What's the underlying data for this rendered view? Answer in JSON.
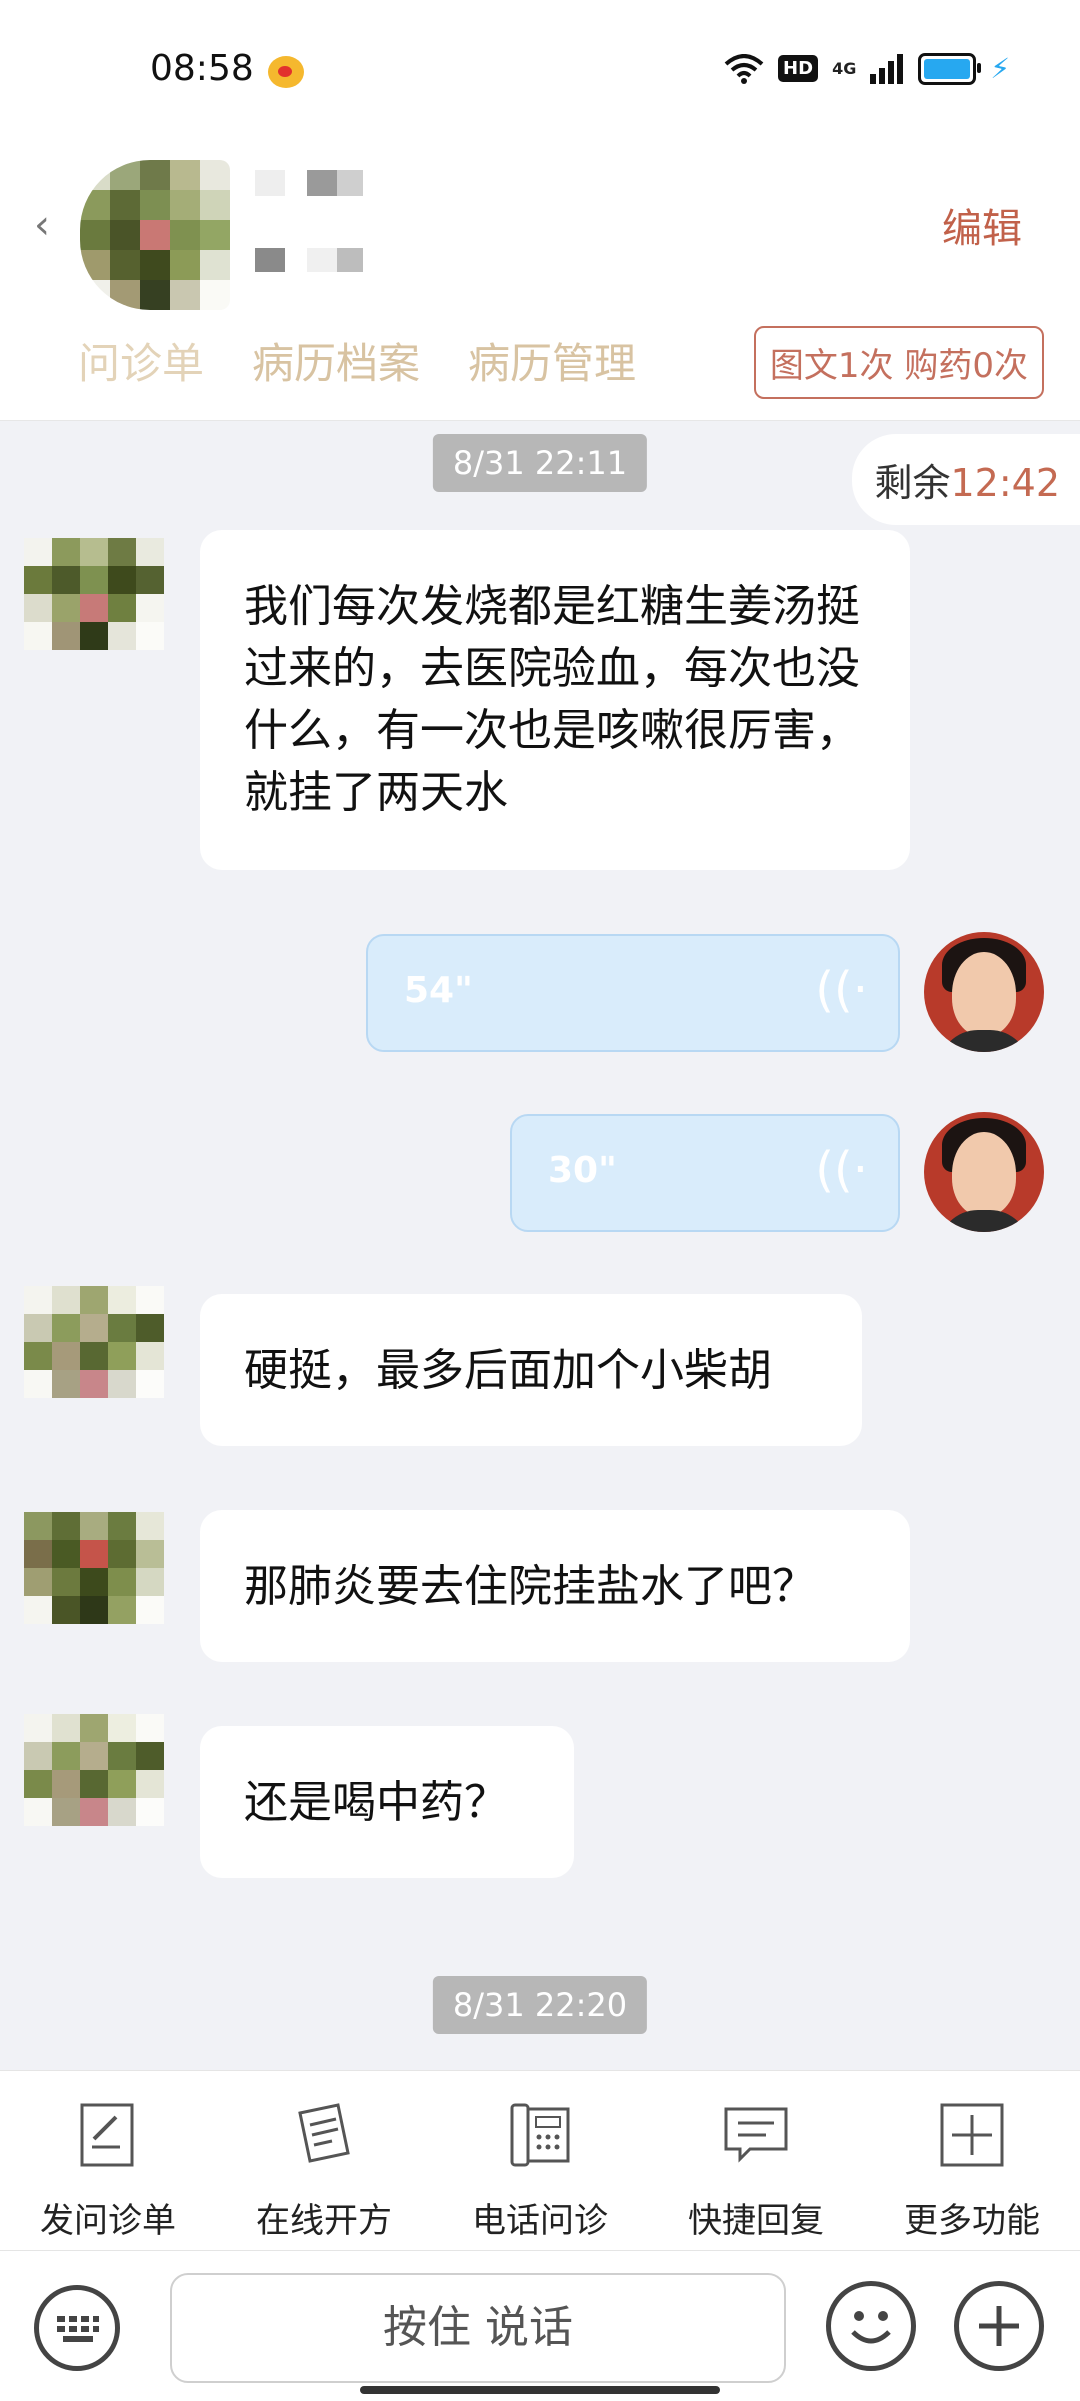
{
  "status": {
    "time": "08:58",
    "hd": "HD",
    "network": "4G"
  },
  "header": {
    "edit": "编辑",
    "tabs": [
      "问诊单",
      "病历档案",
      "病历管理"
    ],
    "counter": "图文1次 购药0次"
  },
  "chat": {
    "time1": "8/31 22:11",
    "remain_label": "剩余",
    "remain_value": "12:42",
    "msg1": "我们每次发烧都是红糖生姜汤挺过来的，去医院验血，每次也没什么，有一次也是咳嗽很厉害，就挂了两天水",
    "voice1": "54\"",
    "voice2": "30\"",
    "msg2": "硬挺，最多后面加个小柴胡",
    "msg3": "那肺炎要去住院挂盐水了吧？",
    "msg4": "还是喝中药？",
    "time2": "8/31 22:20"
  },
  "toolbar": {
    "items": [
      "发问诊单",
      "在线开方",
      "电话问诊",
      "快捷回复",
      "更多功能"
    ]
  },
  "input": {
    "talk": "按住 说话"
  },
  "colors": {
    "accent": "#c4705e",
    "voice_bg": "#d9ecfb",
    "tab_text": "#d8c3a2"
  }
}
